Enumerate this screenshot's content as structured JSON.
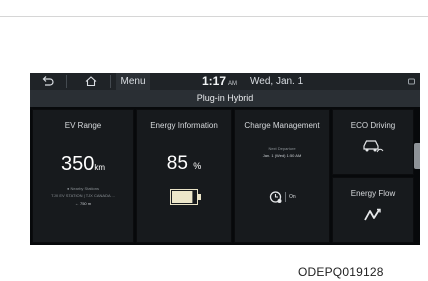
{
  "status_bar": {
    "back_icon": "back-arrow-icon",
    "home_icon": "home-icon",
    "menu_label": "Menu",
    "time": "1:17",
    "ampm": "AM",
    "date": "Wed, Jan. 1"
  },
  "title": "Plug-in Hybrid",
  "tiles": {
    "ev_range": {
      "title": "EV Range",
      "value": "350",
      "unit": "km",
      "nearby_label": "Nearby Stations",
      "stations": "TJX EV STATION | TJX CANADA ...",
      "distance": "← 750 m"
    },
    "energy_information": {
      "title": "Energy Information",
      "value": "85",
      "unit": "%",
      "battery_level": 0.85
    },
    "charge_management": {
      "title": "Charge Management",
      "next_departure_label": "Next Departure",
      "next_departure_value": "Jan. 1 (Wed) 1:50 AM",
      "status": "On"
    },
    "eco_driving": {
      "title": "ECO Driving"
    },
    "energy_flow": {
      "title": "Energy Flow"
    }
  },
  "caption": "ODEPQ019128",
  "colors": {
    "screen_bg": "#07090b",
    "tile_bg": "#171a1d",
    "statusbar_bg": "#1f2327"
  }
}
